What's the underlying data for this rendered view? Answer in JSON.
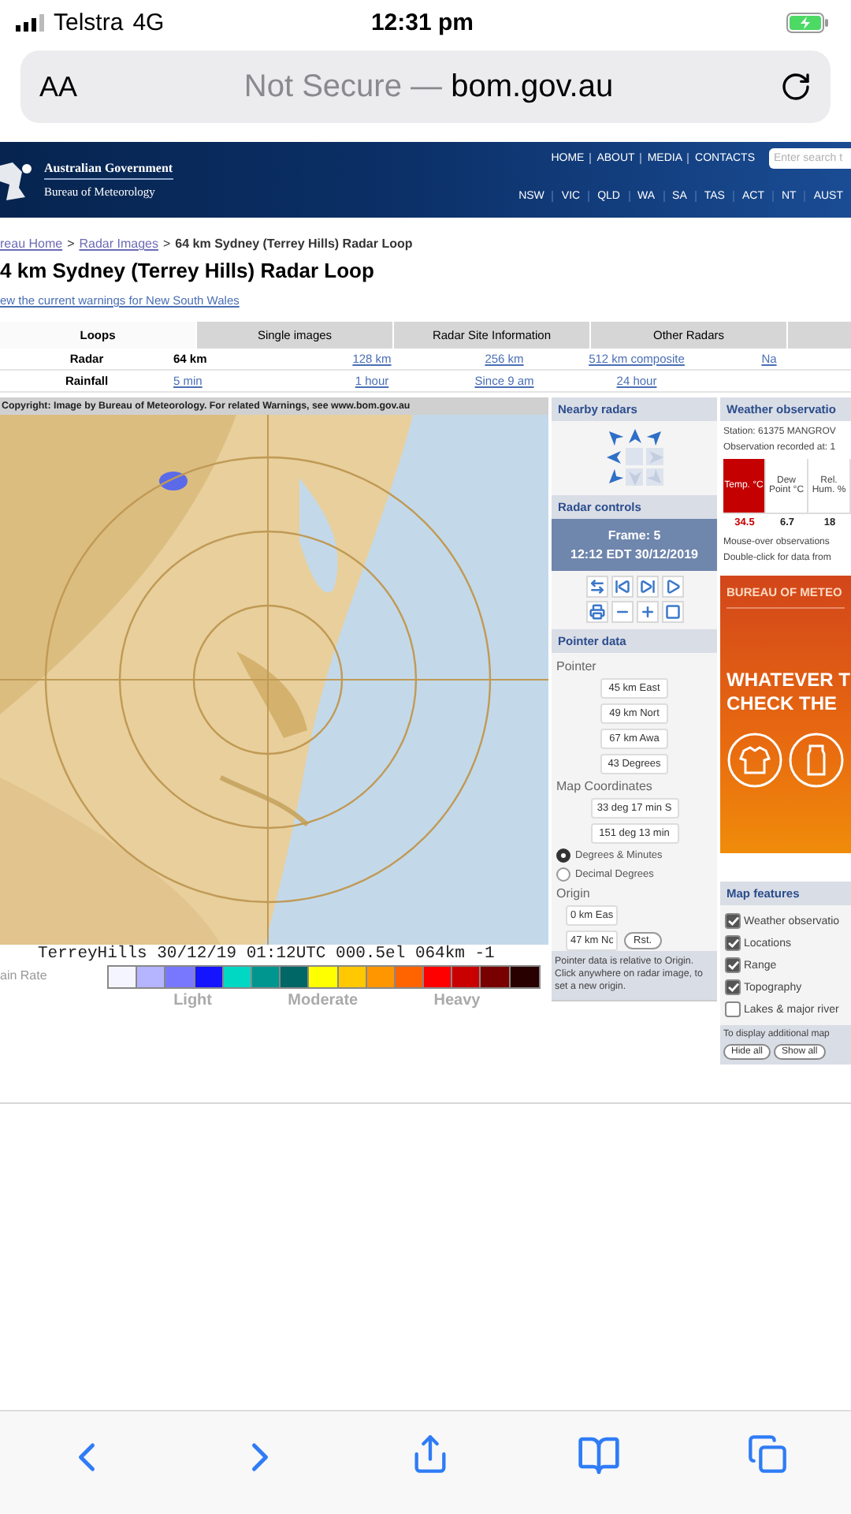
{
  "status_bar": {
    "carrier": "Telstra",
    "network": "4G",
    "time": "12:31 pm"
  },
  "address_bar": {
    "text_size": "AA",
    "security": "Not Secure —",
    "domain": "bom.gov.au"
  },
  "header": {
    "org": "Australian Government",
    "agency": "Bureau of Meteorology",
    "top_links": [
      "HOME",
      "ABOUT",
      "MEDIA",
      "CONTACTS"
    ],
    "search": {
      "placeholder": "Enter search t"
    },
    "states": [
      "NSW",
      "VIC",
      "QLD",
      "WA",
      "SA",
      "TAS",
      "ACT",
      "NT",
      "AUST"
    ]
  },
  "breadcrumb": {
    "separator": ">",
    "items": [
      {
        "label": "reau Home",
        "link": true
      },
      {
        "label": "Radar Images",
        "link": true
      },
      {
        "label": "64 km Sydney (Terrey Hills) Radar Loop",
        "link": false
      }
    ]
  },
  "title": "4 km Sydney (Terrey Hills) Radar Loop",
  "warnings_link": "ew the current warnings for New South Wales",
  "tabs": [
    {
      "label": "Loops",
      "selected": true
    },
    {
      "label": "Single images",
      "selected": false
    },
    {
      "label": "Radar Site Information",
      "selected": false
    },
    {
      "label": "Other Radars",
      "selected": false
    }
  ],
  "product_rows": [
    {
      "label": "Radar",
      "options": [
        {
          "label": "64 km",
          "current": true
        },
        {
          "label": "128 km",
          "current": false
        },
        {
          "label": "256 km",
          "current": false
        },
        {
          "label": "512 km composite",
          "current": false
        },
        {
          "label": "Na",
          "current": false
        }
      ]
    },
    {
      "label": "Rainfall",
      "options": [
        {
          "label": "5 min",
          "current": false
        },
        {
          "label": "1 hour",
          "current": false
        },
        {
          "label": "Since 9 am",
          "current": false
        },
        {
          "label": "24 hour",
          "current": false
        }
      ]
    }
  ],
  "radar": {
    "copyright": "Copyright: Image by Bureau of Meteorology. For related Warnings, see www.bom.gov.au",
    "stamp": "TerreyHills 30/12/19 01:12UTC 000.5el 064km -1"
  },
  "legend": {
    "label": "ain Rate",
    "levels": [
      "Light",
      "Moderate",
      "Heavy"
    ],
    "swatches": [
      {
        "color": "#f5f5ff"
      },
      {
        "color": "#b4b4ff"
      },
      {
        "color": "#7878ff"
      },
      {
        "color": "#1414ff"
      },
      {
        "color": "#00d8c3"
      },
      {
        "color": "#009690"
      },
      {
        "color": "#006666"
      },
      {
        "color": "#ffff00"
      },
      {
        "color": "#ffc800"
      },
      {
        "color": "#ff9600"
      },
      {
        "color": "#ff6400"
      },
      {
        "color": "#ff0000"
      },
      {
        "color": "#c80000"
      },
      {
        "color": "#780000"
      },
      {
        "color": "#280000"
      }
    ]
  },
  "nearby_radars": {
    "title": "Nearby radars",
    "arrows": [
      {
        "enabled": true
      },
      {
        "enabled": true
      },
      {
        "enabled": true
      },
      {
        "enabled": true
      },
      {
        "enabled": false
      },
      {
        "enabled": true
      },
      {
        "enabled": false
      },
      {
        "enabled": false
      }
    ]
  },
  "radar_controls": {
    "title": "Radar controls",
    "frame": "Frame: 5",
    "time": "12:12 EDT 30/12/2019",
    "buttons": [
      {
        "kind": "swap"
      },
      {
        "kind": "first"
      },
      {
        "kind": "last"
      },
      {
        "kind": "play"
      },
      {
        "kind": "print"
      },
      {
        "kind": "slower"
      },
      {
        "kind": "faster"
      },
      {
        "kind": "stop"
      }
    ]
  },
  "pointer_data": {
    "title": "Pointer data",
    "pointer_label": "Pointer",
    "pointer_fields": [
      "45 km East",
      "49 km Nort",
      "67 km Awa",
      "43 Degrees"
    ],
    "coords_label": "Map Coordinates",
    "coord_fields": [
      "33 deg 17 min S",
      "151 deg 13 min"
    ],
    "formats": [
      {
        "label": "Degrees & Minutes",
        "selected": true
      },
      {
        "label": "Decimal Degrees",
        "selected": false
      }
    ],
    "origin_label": "Origin",
    "origin_fields": [
      "0 km Eas",
      "47 km No"
    ],
    "reset": "Rst.",
    "note": "Pointer data is relative to Origin. Click anywhere on radar image, to set a new origin."
  },
  "observations": {
    "title": "Weather observatio",
    "station": "Station: 61375 MANGROV",
    "recorded": "Observation recorded at: 1",
    "columns": [
      {
        "label": "Temp. °C",
        "highlight": true
      },
      {
        "label": "Dew Point °C",
        "highlight": false
      },
      {
        "label": "Rel. Hum. %",
        "highlight": false
      }
    ],
    "values": [
      "34.5",
      "6.7",
      "18"
    ],
    "notes": [
      "Mouse-over observations",
      "Double-click for data from"
    ]
  },
  "ad": {
    "brand": "BUREAU OF METEO",
    "headline": [
      "WHATEVER T",
      "CHECK THE"
    ]
  },
  "map_features": {
    "title": "Map features",
    "items": [
      {
        "label": "Weather observatio",
        "checked": true
      },
      {
        "label": "Locations",
        "checked": true
      },
      {
        "label": "Range",
        "checked": true
      },
      {
        "label": "Topography",
        "checked": true
      },
      {
        "label": "Lakes & major river",
        "checked": false
      }
    ],
    "note": "To display additional map",
    "buttons": [
      "Hide all",
      "Show all"
    ]
  }
}
